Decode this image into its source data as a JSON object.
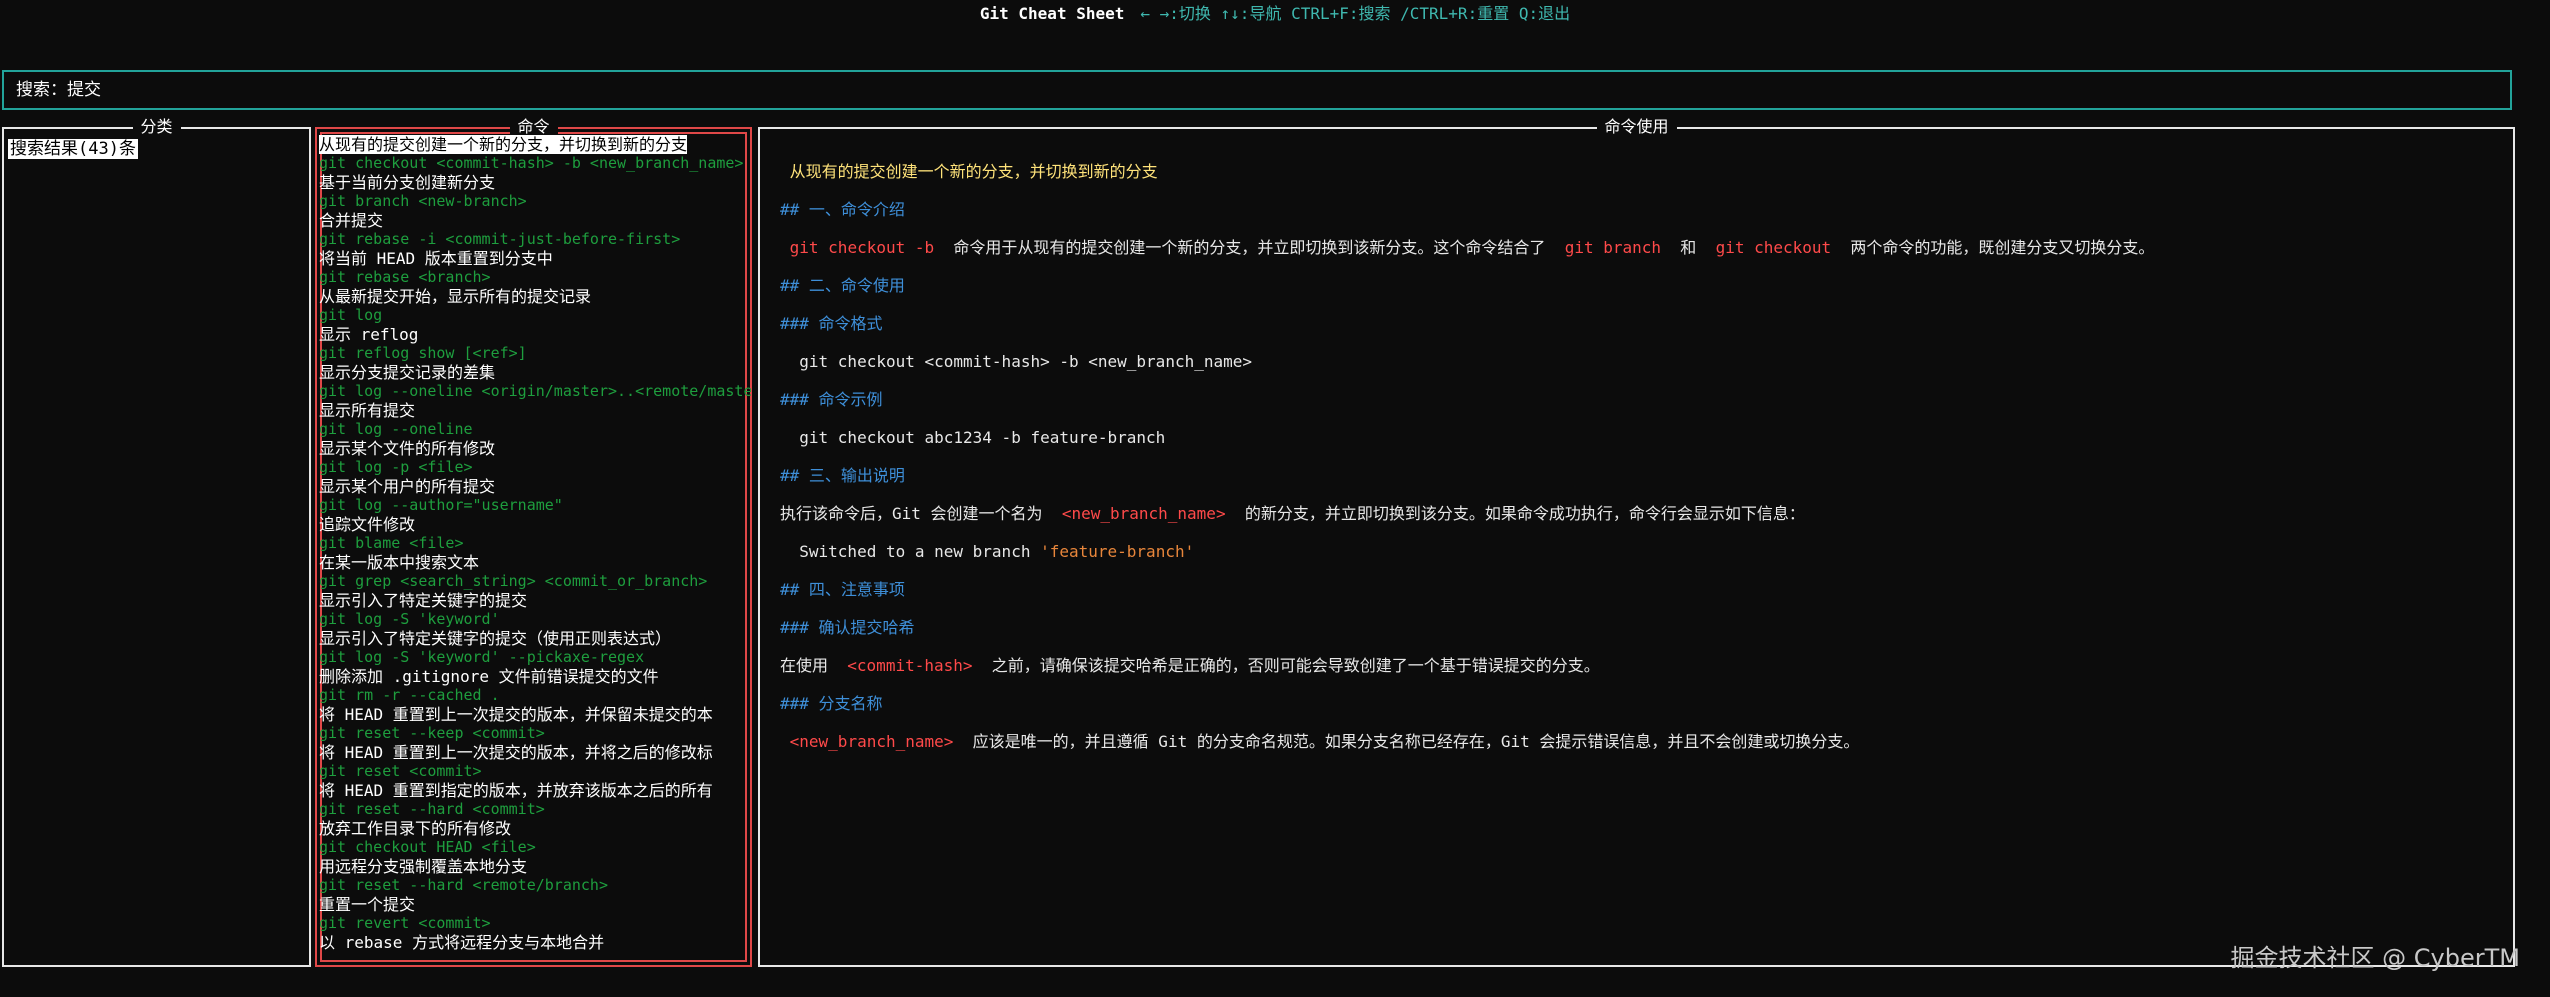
{
  "header": {
    "title": "Git Cheat Sheet",
    "hint": "← →:切换 ↑↓:导航 CTRL+F:搜索 /CTRL+R:重置 Q:退出"
  },
  "search": {
    "label": "搜索：提交"
  },
  "panels": {
    "category_title": "分类",
    "command_title": "命令",
    "usage_title": "命令使用"
  },
  "category": {
    "result": "搜索结果(43)条"
  },
  "commands": [
    {
      "desc": "从现有的提交创建一个新的分支，并切换到新的分支",
      "code": "git checkout <commit-hash> -b <new_branch_name>"
    },
    {
      "desc": "基于当前分支创建新分支",
      "code": "git branch <new-branch>"
    },
    {
      "desc": "合并提交",
      "code": "git rebase -i <commit-just-before-first>"
    },
    {
      "desc": "将当前 HEAD 版本重置到分支中",
      "code": "git rebase <branch>"
    },
    {
      "desc": "从最新提交开始，显示所有的提交记录",
      "code": "git log"
    },
    {
      "desc": "显示 reflog",
      "code": "git reflog show [<ref>]"
    },
    {
      "desc": "显示分支提交记录的差集",
      "code": "git log --oneline <origin/master>..<remote/master>"
    },
    {
      "desc": "显示所有提交",
      "code": "git log --oneline"
    },
    {
      "desc": "显示某个文件的所有修改",
      "code": "git log -p <file>"
    },
    {
      "desc": "显示某个用户的所有提交",
      "code": "git log --author=\"username\""
    },
    {
      "desc": "追踪文件修改",
      "code": "git blame <file>"
    },
    {
      "desc": "在某一版本中搜索文本",
      "code": "git grep <search_string> <commit_or_branch>"
    },
    {
      "desc": "显示引入了特定关键字的提交",
      "code": "git log -S 'keyword'"
    },
    {
      "desc": "显示引入了特定关键字的提交（使用正则表达式）",
      "code": "git log -S 'keyword' --pickaxe-regex"
    },
    {
      "desc": "删除添加 .gitignore 文件前错误提交的文件",
      "code": "git rm -r --cached ."
    },
    {
      "desc": "将 HEAD 重置到上一次提交的版本，并保留未提交的本",
      "code": "git reset --keep <commit>"
    },
    {
      "desc": "将 HEAD 重置到上一次提交的版本，并将之后的修改标",
      "code": "git reset <commit>"
    },
    {
      "desc": "将 HEAD 重置到指定的版本，并放弃该版本之后的所有",
      "code": "git reset --hard <commit>"
    },
    {
      "desc": "放弃工作目录下的所有修改",
      "code": "git checkout HEAD <file>"
    },
    {
      "desc": "用远程分支强制覆盖本地分支",
      "code": "git reset --hard <remote/branch>"
    },
    {
      "desc": "重置一个提交",
      "code": "git revert <commit>"
    },
    {
      "desc": "以 rebase 方式将远程分支与本地合并",
      "code": ""
    }
  ],
  "usage": {
    "summary": "从现有的提交创建一个新的分支，并切换到新的分支",
    "h_intro": "## 一、命令介绍",
    "intro_cmd": "git checkout -b",
    "intro_text1": "命令用于从现有的提交创建一个新的分支，并立即切换到该新分支。这个命令结合了",
    "intro_branch": "git branch",
    "intro_and": "和",
    "intro_checkout": "git checkout",
    "intro_text2": "两个命令的功能，既创建分支又切换分支。",
    "h_usage": "## 二、命令使用",
    "h_format": "### 命令格式",
    "format": "git checkout <commit-hash> -b <new_branch_name>",
    "h_example": "### 命令示例",
    "example": "git checkout abc1234 -b feature-branch",
    "h_output": "## 三、输出说明",
    "output_text1": "执行该命令后，Git 会创建一个名为",
    "output_name": "<new_branch_name>",
    "output_text2": "的新分支，并立即切换到该分支。如果命令成功执行，命令行会显示如下信息：",
    "switched_prefix": "Switched to a new branch ",
    "switched_name": "'feature-branch'",
    "h_notes": "## 四、注意事项",
    "h_confirm": "### 确认提交哈希",
    "confirm_text1": "在使用",
    "confirm_hash": "<commit-hash>",
    "confirm_text2": "之前，请确保该提交哈希是正确的，否则可能会导致创建了一个基于错误提交的分支。",
    "h_name": "### 分支名称",
    "name_tag": "<new_branch_name>",
    "name_text": "应该是唯一的，并且遵循 Git 的分支命名规范。如果分支名称已经存在，Git 会提示错误信息，并且不会创建或切换分支。"
  },
  "watermark": "掘金技术社区 @ CyberTM",
  "colors": {
    "accent": "#22a39a",
    "command_code": "#1e9e3e",
    "heading": "#3e8fd9",
    "highlight": "#ff4a4a",
    "summary": "#ffe37a",
    "string": "#e8863b",
    "selected_border": "#e04848"
  }
}
